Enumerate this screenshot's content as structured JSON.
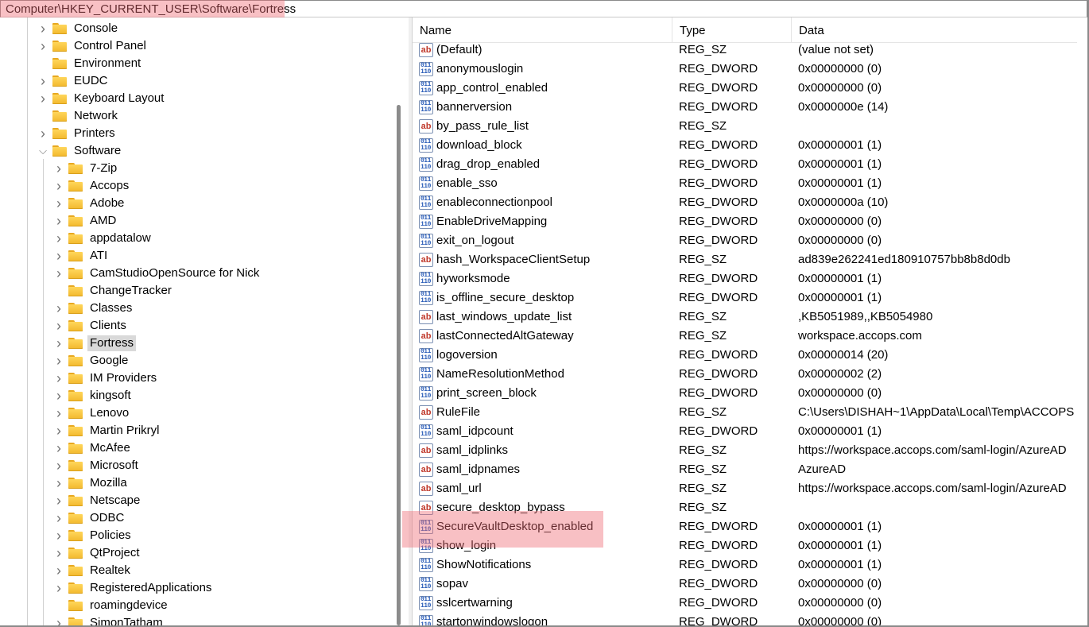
{
  "address": {
    "path": "Computer\\HKEY_CURRENT_USER\\Software\\Fortress"
  },
  "tree": {
    "items": [
      {
        "label": "Console",
        "level": 1,
        "expanded": false
      },
      {
        "label": "Control Panel",
        "level": 1,
        "expanded": false
      },
      {
        "label": "Environment",
        "level": 1,
        "expanded": null
      },
      {
        "label": "EUDC",
        "level": 1,
        "expanded": false
      },
      {
        "label": "Keyboard Layout",
        "level": 1,
        "expanded": false
      },
      {
        "label": "Network",
        "level": 1,
        "expanded": null
      },
      {
        "label": "Printers",
        "level": 1,
        "expanded": false
      },
      {
        "label": "Software",
        "level": 1,
        "expanded": true
      },
      {
        "label": "7-Zip",
        "level": 2,
        "expanded": false
      },
      {
        "label": "Accops",
        "level": 2,
        "expanded": false
      },
      {
        "label": "Adobe",
        "level": 2,
        "expanded": false
      },
      {
        "label": "AMD",
        "level": 2,
        "expanded": false
      },
      {
        "label": "appdatalow",
        "level": 2,
        "expanded": false
      },
      {
        "label": "ATI",
        "level": 2,
        "expanded": false
      },
      {
        "label": "CamStudioOpenSource for Nick",
        "level": 2,
        "expanded": false
      },
      {
        "label": "ChangeTracker",
        "level": 2,
        "expanded": null
      },
      {
        "label": "Classes",
        "level": 2,
        "expanded": false
      },
      {
        "label": "Clients",
        "level": 2,
        "expanded": false
      },
      {
        "label": "Fortress",
        "level": 2,
        "expanded": false,
        "selected": true
      },
      {
        "label": "Google",
        "level": 2,
        "expanded": false
      },
      {
        "label": "IM Providers",
        "level": 2,
        "expanded": false
      },
      {
        "label": "kingsoft",
        "level": 2,
        "expanded": false
      },
      {
        "label": "Lenovo",
        "level": 2,
        "expanded": false
      },
      {
        "label": "Martin Prikryl",
        "level": 2,
        "expanded": false
      },
      {
        "label": "McAfee",
        "level": 2,
        "expanded": false
      },
      {
        "label": "Microsoft",
        "level": 2,
        "expanded": false
      },
      {
        "label": "Mozilla",
        "level": 2,
        "expanded": false
      },
      {
        "label": "Netscape",
        "level": 2,
        "expanded": false
      },
      {
        "label": "ODBC",
        "level": 2,
        "expanded": false
      },
      {
        "label": "Policies",
        "level": 2,
        "expanded": false
      },
      {
        "label": "QtProject",
        "level": 2,
        "expanded": false
      },
      {
        "label": "Realtek",
        "level": 2,
        "expanded": false
      },
      {
        "label": "RegisteredApplications",
        "level": 2,
        "expanded": false
      },
      {
        "label": "roamingdevice",
        "level": 2,
        "expanded": null
      },
      {
        "label": "SimonTatham",
        "level": 2,
        "expanded": false
      }
    ]
  },
  "list": {
    "columns": {
      "name": "Name",
      "type": "Type",
      "data": "Data"
    },
    "rows": [
      {
        "name": "(Default)",
        "type": "REG_SZ",
        "data": "(value not set)"
      },
      {
        "name": "anonymouslogin",
        "type": "REG_DWORD",
        "data": "0x00000000 (0)"
      },
      {
        "name": "app_control_enabled",
        "type": "REG_DWORD",
        "data": "0x00000000 (0)"
      },
      {
        "name": "bannerversion",
        "type": "REG_DWORD",
        "data": "0x0000000e (14)"
      },
      {
        "name": "by_pass_rule_list",
        "type": "REG_SZ",
        "data": ""
      },
      {
        "name": "download_block",
        "type": "REG_DWORD",
        "data": "0x00000001 (1)"
      },
      {
        "name": "drag_drop_enabled",
        "type": "REG_DWORD",
        "data": "0x00000001 (1)"
      },
      {
        "name": "enable_sso",
        "type": "REG_DWORD",
        "data": "0x00000001 (1)"
      },
      {
        "name": "enableconnectionpool",
        "type": "REG_DWORD",
        "data": "0x0000000a (10)"
      },
      {
        "name": "EnableDriveMapping",
        "type": "REG_DWORD",
        "data": "0x00000000 (0)"
      },
      {
        "name": "exit_on_logout",
        "type": "REG_DWORD",
        "data": "0x00000000 (0)"
      },
      {
        "name": "hash_WorkspaceClientSetup",
        "type": "REG_SZ",
        "data": "ad839e262241ed180910757bb8b8d0db"
      },
      {
        "name": "hyworksmode",
        "type": "REG_DWORD",
        "data": "0x00000001 (1)"
      },
      {
        "name": "is_offline_secure_desktop",
        "type": "REG_DWORD",
        "data": "0x00000001 (1)"
      },
      {
        "name": "last_windows_update_list",
        "type": "REG_SZ",
        "data": ",KB5051989,,KB5054980"
      },
      {
        "name": "lastConnectedAltGateway",
        "type": "REG_SZ",
        "data": "workspace.accops.com"
      },
      {
        "name": "logoversion",
        "type": "REG_DWORD",
        "data": "0x00000014 (20)"
      },
      {
        "name": "NameResolutionMethod",
        "type": "REG_DWORD",
        "data": "0x00000002 (2)"
      },
      {
        "name": "print_screen_block",
        "type": "REG_DWORD",
        "data": "0x00000000 (0)"
      },
      {
        "name": "RuleFile",
        "type": "REG_SZ",
        "data": "C:\\Users\\DISHAH~1\\AppData\\Local\\Temp\\ACCOPS"
      },
      {
        "name": "saml_idpcount",
        "type": "REG_DWORD",
        "data": "0x00000001 (1)"
      },
      {
        "name": "saml_idplinks",
        "type": "REG_SZ",
        "data": "https://workspace.accops.com/saml-login/AzureAD"
      },
      {
        "name": "saml_idpnames",
        "type": "REG_SZ",
        "data": "AzureAD"
      },
      {
        "name": "saml_url",
        "type": "REG_SZ",
        "data": "https://workspace.accops.com/saml-login/AzureAD"
      },
      {
        "name": "secure_desktop_bypass",
        "type": "REG_SZ",
        "data": ""
      },
      {
        "name": "SecureVaultDesktop_enabled",
        "type": "REG_DWORD",
        "data": "0x00000001 (1)",
        "highlighted": true
      },
      {
        "name": "show_login",
        "type": "REG_DWORD",
        "data": "0x00000001 (1)"
      },
      {
        "name": "ShowNotifications",
        "type": "REG_DWORD",
        "data": "0x00000001 (1)"
      },
      {
        "name": "sopav",
        "type": "REG_DWORD",
        "data": "0x00000000 (0)"
      },
      {
        "name": "sslcertwarning",
        "type": "REG_DWORD",
        "data": "0x00000000 (0)"
      },
      {
        "name": "startonwindowslogon",
        "type": "REG_DWORD",
        "data": "0x00000000 (0)"
      }
    ]
  },
  "icons": {
    "string_value": "ab",
    "dword_value": "011 110"
  },
  "colors": {
    "highlight": "#ef6973",
    "selection": "#d9d9d9",
    "folder": "#f2b82c"
  }
}
